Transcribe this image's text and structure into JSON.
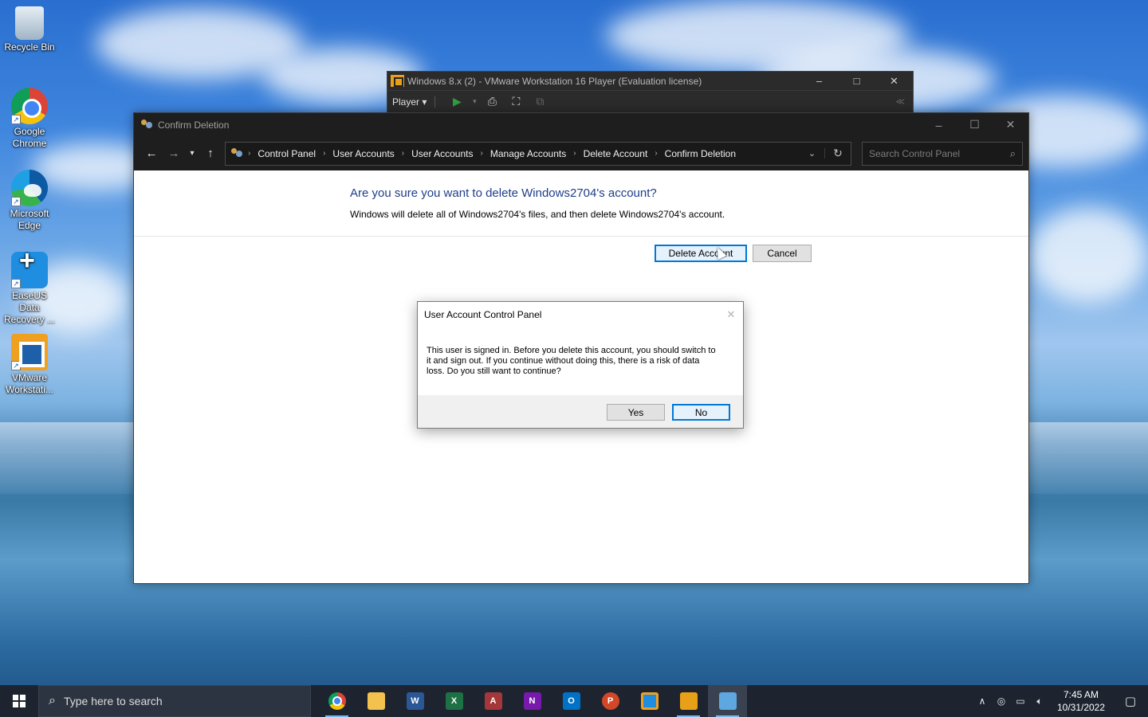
{
  "desktop": {
    "icons": [
      {
        "label": "Recycle Bin",
        "icon": "recycle-bin-icon"
      },
      {
        "label": "Google Chrome",
        "icon": "chrome-icon"
      },
      {
        "label": "Microsoft Edge",
        "icon": "edge-icon"
      },
      {
        "label": "EaseUS Data Recovery ...",
        "icon": "easeus-icon"
      },
      {
        "label": "VMware Workstati...",
        "icon": "vmware-icon"
      }
    ]
  },
  "vmware": {
    "title": "Windows 8.x (2) - VMware Workstation 16 Player (Evaluation license)",
    "player_menu": "Player",
    "controls": {
      "minimize": "–",
      "maximize": "□",
      "close": "✕"
    }
  },
  "control_panel": {
    "title": "Confirm Deletion",
    "breadcrumb": [
      "Control Panel",
      "User Accounts",
      "User Accounts",
      "Manage Accounts",
      "Delete Account",
      "Confirm Deletion"
    ],
    "search_placeholder": "Search Control Panel",
    "heading": "Are you sure you want to delete Windows2704's account?",
    "subtext": "Windows will delete all of Windows2704's files, and then delete Windows2704's account.",
    "delete_button": "Delete Account",
    "cancel_button": "Cancel"
  },
  "dialog": {
    "title": "User Account Control Panel",
    "message": "This user is signed in. Before you delete this account, you should switch to it and sign out. If you continue without doing this, there is a risk of data loss. Do you still want to continue?",
    "yes_button": "Yes",
    "no_button": "No"
  },
  "taskbar": {
    "search_placeholder": "Type here to search",
    "apps": [
      {
        "name": "chrome-icon",
        "running": true
      },
      {
        "name": "file-explorer-icon",
        "running": false
      },
      {
        "name": "word-icon",
        "running": false
      },
      {
        "name": "excel-icon",
        "running": false
      },
      {
        "name": "access-icon",
        "running": false
      },
      {
        "name": "onenote-icon",
        "running": false
      },
      {
        "name": "outlook-icon",
        "running": false
      },
      {
        "name": "powerpoint-icon",
        "running": false
      },
      {
        "name": "vmware-workstation-icon",
        "running": false
      },
      {
        "name": "vmware-player-icon",
        "running": true
      },
      {
        "name": "control-panel-icon",
        "running": true,
        "active": true
      }
    ],
    "time": "7:45 AM",
    "date": "10/31/2022"
  },
  "colors": {
    "heading_blue": "#1e3d8a",
    "default_button_border": "#0078d7",
    "titlebar_dark": "#1e1e1e",
    "taskbar_bg": "#1d2430"
  }
}
